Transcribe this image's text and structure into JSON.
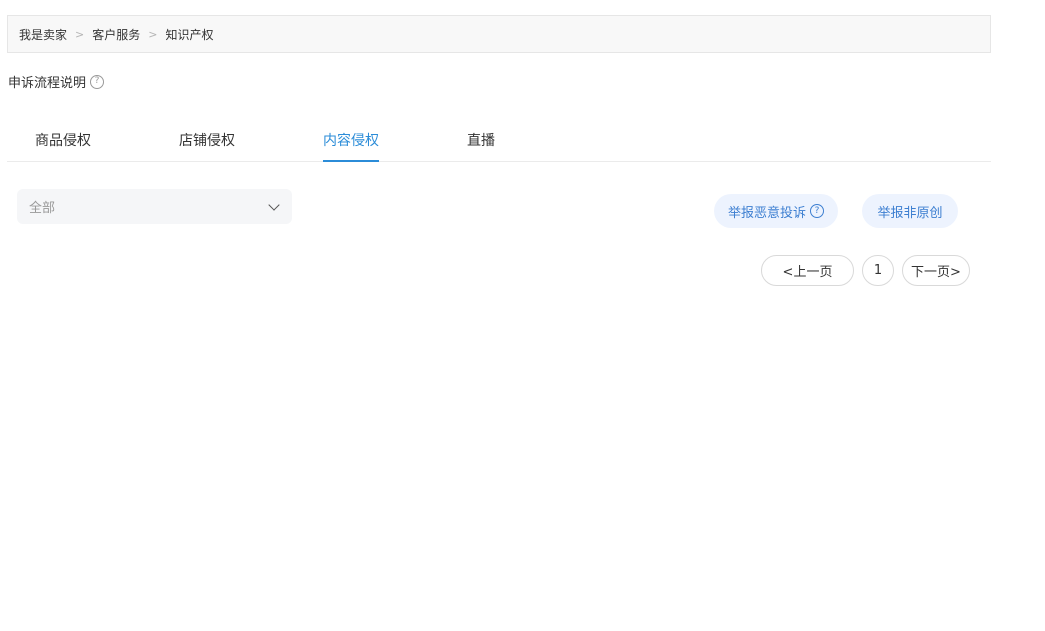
{
  "breadcrumb": {
    "items": [
      "我是卖家",
      "客户服务",
      "知识产权"
    ],
    "separator": ">"
  },
  "appeal": {
    "label": "申诉流程说明",
    "help_icon_glyph": "?"
  },
  "tabs": [
    {
      "label": "商品侵权",
      "active": false
    },
    {
      "label": "店铺侵权",
      "active": false
    },
    {
      "label": "内容侵权",
      "active": true
    },
    {
      "label": "直播",
      "active": false
    }
  ],
  "filter": {
    "selected": "全部"
  },
  "actions": {
    "report_malicious": "举报恶意投诉",
    "report_non_original": "举报非原创",
    "help_icon_glyph": "?"
  },
  "pagination": {
    "prev": "<上一页",
    "current": "1",
    "next": "下一页>"
  },
  "colors": {
    "accent": "#2b8cd8",
    "action_bg": "#edf3fe",
    "action_text": "#3d7fd1"
  }
}
